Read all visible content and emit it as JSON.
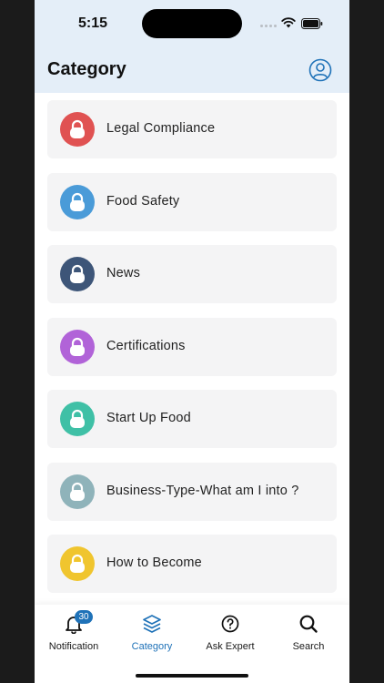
{
  "status_bar": {
    "time": "5:15"
  },
  "header": {
    "title": "Category"
  },
  "colors": {
    "accent": "#1f72b8",
    "header_bg": "#e4eef8",
    "card_bg": "#f4f4f5"
  },
  "categories": [
    {
      "label": "Legal Compliance",
      "color": "#e05252",
      "icon": "lock-icon"
    },
    {
      "label": "Food Safety",
      "color": "#4a9bd8",
      "icon": "lock-icon"
    },
    {
      "label": "News",
      "color": "#3d5578",
      "icon": "lock-icon"
    },
    {
      "label": "Certifications",
      "color": "#b163d8",
      "icon": "lock-icon"
    },
    {
      "label": "Start Up Food",
      "color": "#3fc0a6",
      "icon": "lock-icon"
    },
    {
      "label": "Business-Type-What am I into ?",
      "color": "#8fb3ba",
      "icon": "lock-icon"
    },
    {
      "label": "How to Become",
      "color": "#f0c52e",
      "icon": "lock-icon"
    }
  ],
  "tabbar": {
    "notification": {
      "label": "Notification",
      "badge": "30",
      "icon": "bell-icon"
    },
    "category": {
      "label": "Category",
      "icon": "layers-icon",
      "active": true
    },
    "ask_expert": {
      "label": "Ask Expert",
      "icon": "question-circle-icon"
    },
    "search": {
      "label": "Search",
      "icon": "search-icon"
    }
  }
}
